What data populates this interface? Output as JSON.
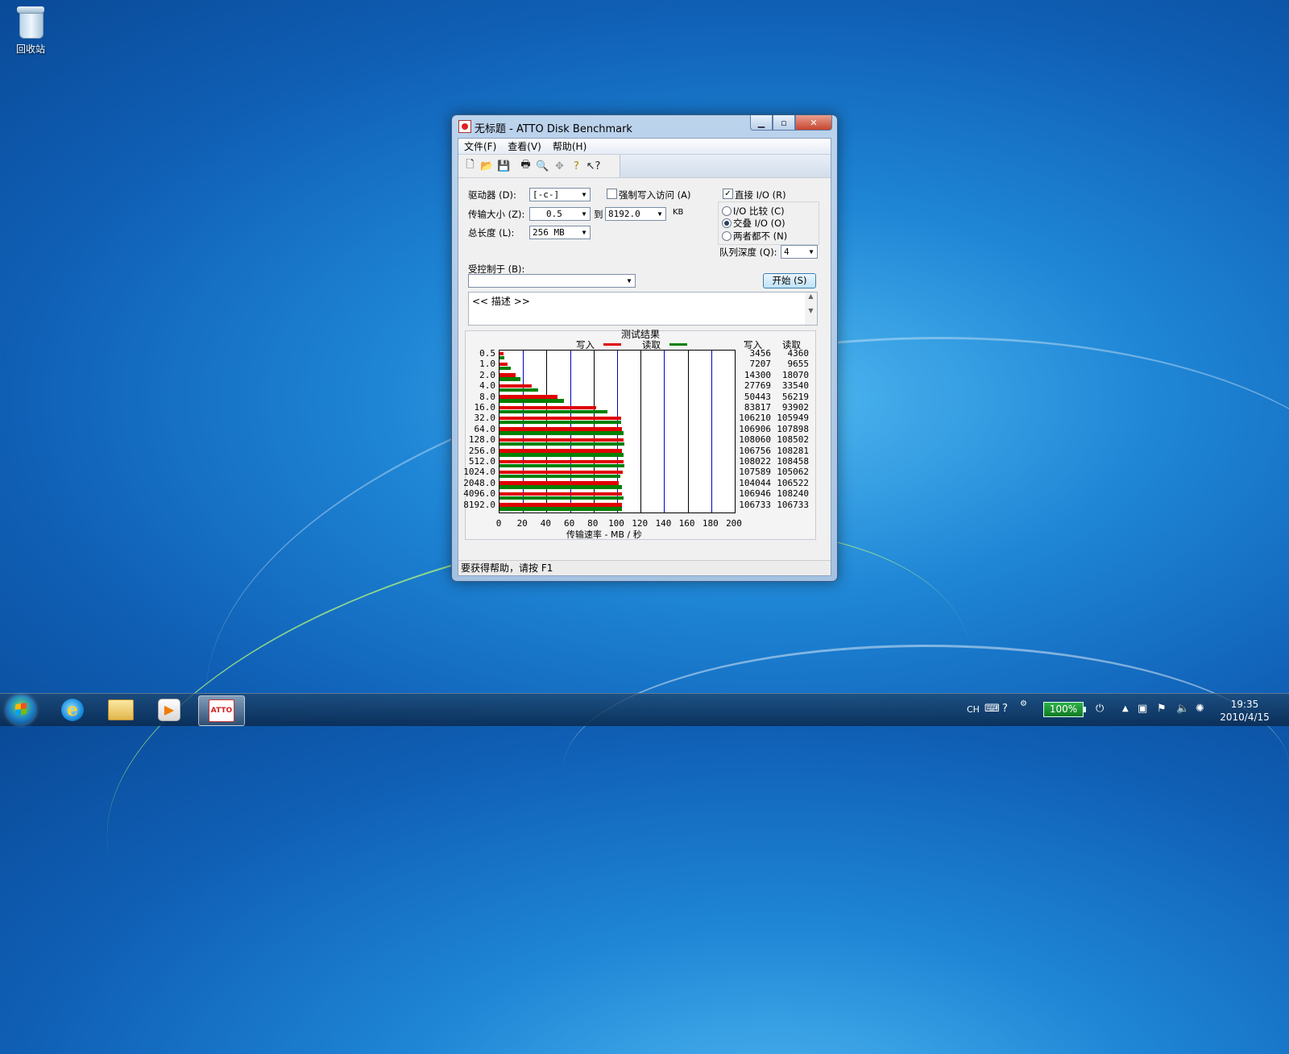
{
  "desktop": {
    "recycle_bin_label": "回收站"
  },
  "window": {
    "title": "无标题 - ATTO Disk Benchmark",
    "controls": {
      "minimize": "▁",
      "maximize": "▫",
      "close": "✕"
    },
    "menu": [
      "文件(F)",
      "查看(V)",
      "帮助(H)"
    ],
    "toolbar_icons": [
      "new-icon",
      "open-icon",
      "save-icon",
      "print-icon",
      "print-preview-icon",
      "move-icon",
      "help-icon",
      "context-help-icon"
    ]
  },
  "settings": {
    "drive_label": "驱动器 (D):",
    "drive_value": "[-c-]",
    "force_write_label": "强制写入访问 (A)",
    "force_write_checked": false,
    "transfer_label": "传输大小 (Z):",
    "transfer_from": "0.5",
    "to_label": "到",
    "transfer_to": "8192.0",
    "unit": "KB",
    "length_label": "总长度 (L):",
    "length_value": "256 MB",
    "direct_io_label": "直接 I/O (R)",
    "direct_io_checked": true,
    "io_compare_label": "I/O 比较 (C)",
    "overlapped_io_label": "交叠 I/O (O)",
    "neither_label": "两者都不 (N)",
    "selected_mode": "overlapped",
    "queue_label": "队列深度 (Q):",
    "queue_value": "4",
    "controlled_by_label": "受控制于 (B):",
    "controlled_by_value": "",
    "start_button": "开始 (S)",
    "description": "<< 描述 >>"
  },
  "chart_data": {
    "type": "bar",
    "orientation": "horizontal",
    "title": "测试结果",
    "xlabel": "传输速率 - MB / 秒",
    "xlim": [
      0,
      200
    ],
    "xticks": [
      0,
      20,
      40,
      60,
      80,
      100,
      120,
      140,
      160,
      180,
      200
    ],
    "categories": [
      "0.5",
      "1.0",
      "2.0",
      "4.0",
      "8.0",
      "16.0",
      "32.0",
      "64.0",
      "128.0",
      "256.0",
      "512.0",
      "1024.0",
      "2048.0",
      "4096.0",
      "8192.0"
    ],
    "series": [
      {
        "name": "写入",
        "color": "#e00000",
        "unit": "KB/s",
        "values": [
          3456,
          7207,
          14300,
          27769,
          50443,
          83817,
          106210,
          106906,
          108060,
          106756,
          108022,
          107589,
          104044,
          106946,
          106733
        ]
      },
      {
        "name": "读取",
        "color": "#008000",
        "unit": "KB/s",
        "values": [
          4360,
          9655,
          18070,
          33540,
          56219,
          93902,
          105949,
          107898,
          108502,
          108281,
          108458,
          105062,
          106522,
          108240,
          106733
        ]
      }
    ],
    "column_headers": [
      "写入",
      "读取"
    ]
  },
  "statusbar": {
    "text": "要获得帮助，请按 F1"
  },
  "taskbar": {
    "apps": [
      "ie-icon",
      "explorer-icon",
      "media-player-icon",
      "atto-icon"
    ],
    "atto_label": "ATTO",
    "lang": "CH",
    "battery": "100%",
    "time": "19:35",
    "date": "2010/4/15"
  }
}
